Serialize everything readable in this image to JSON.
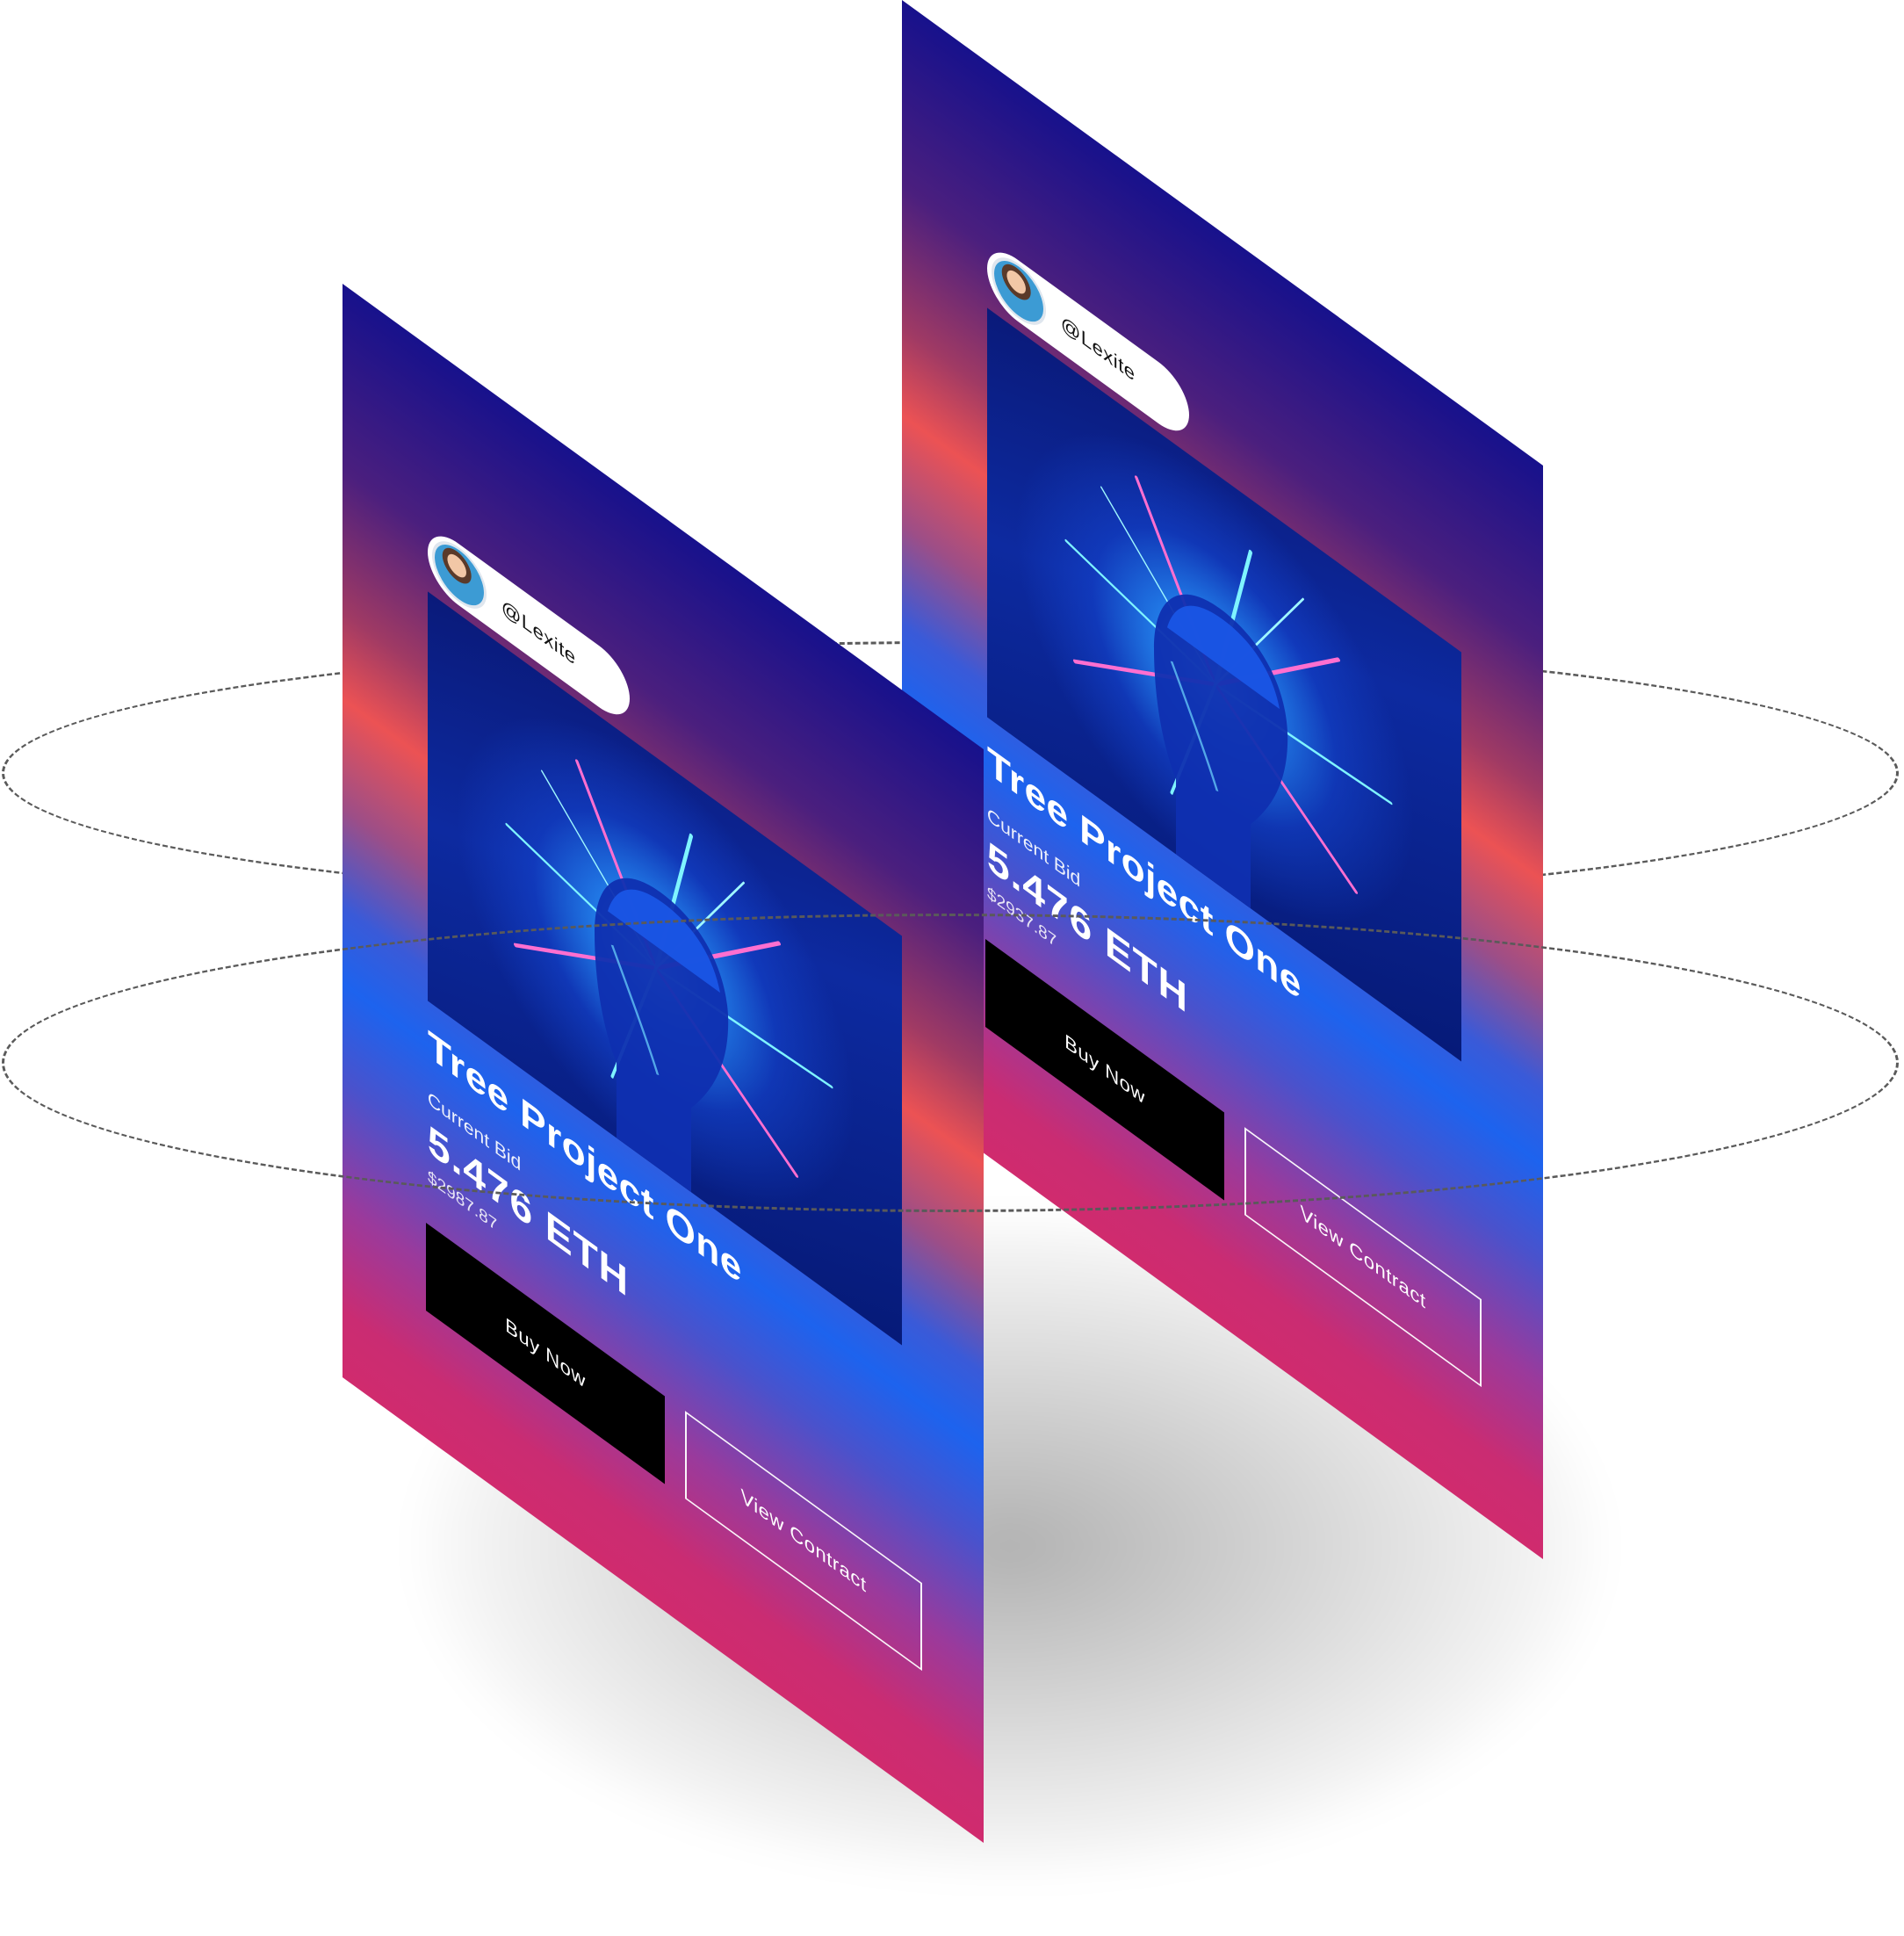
{
  "cards": [
    {
      "username": "@Lexite",
      "title": "Tree Project One",
      "bid_label": "Current Bid",
      "bid_value": "5.476 ETH",
      "bid_usd": "$2987.87",
      "buy_label": "Buy Now",
      "view_label": "View Contract"
    },
    {
      "username": "@Lexite",
      "title": "Tree Project One",
      "bid_label": "Current Bid",
      "bid_value": "5.476 ETH",
      "bid_usd": "$2937.87",
      "buy_label": "Buy Now",
      "view_label": "View Contract"
    }
  ],
  "colors": {
    "card_top": "#17118c",
    "card_mid_coral": "#ec5254",
    "card_mid_blue": "#1d63ee",
    "card_bottom": "#d02b6e",
    "buy_button": "#000000",
    "pill": "#ffffff"
  },
  "icons": {
    "avatar": "user-avatar-icon"
  }
}
